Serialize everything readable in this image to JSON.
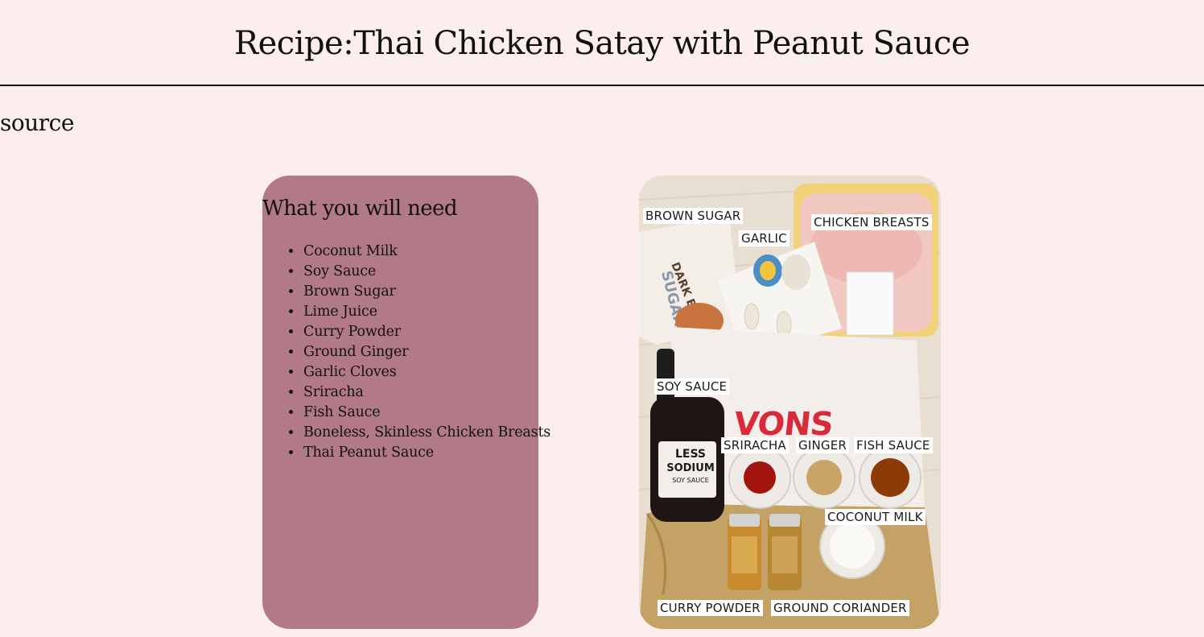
{
  "header": {
    "title": "Recipe:Thai Chicken Satay with Peanut Sauce"
  },
  "source": {
    "label": "source"
  },
  "ingredients": {
    "heading": "What you will need",
    "items": [
      "Coconut Milk",
      "Soy Sauce",
      "Brown Sugar",
      "Lime Juice",
      "Curry Powder",
      "Ground Ginger",
      "Garlic Cloves",
      "Sriracha",
      "Fish Sauce",
      "Boneless, Skinless Chicken Breasts",
      "Thai Peanut Sauce"
    ]
  },
  "photo": {
    "brand": "VONS",
    "labels": {
      "brown_sugar": "BROWN SUGAR",
      "garlic": "GARLIC",
      "chicken_breasts": "CHICKEN BREASTS",
      "soy_sauce": "SOY SAUCE",
      "sriracha": "SRIRACHA",
      "ginger": "GINGER",
      "fish_sauce": "FISH SAUCE",
      "coconut_milk": "COCONUT MILK",
      "curry_powder": "CURRY POWDER",
      "ground_coriander": "GROUND CORIANDER"
    }
  },
  "colors": {
    "background": "#fdeeee",
    "card": "#b27a87",
    "brand_red": "#d92a3b"
  }
}
